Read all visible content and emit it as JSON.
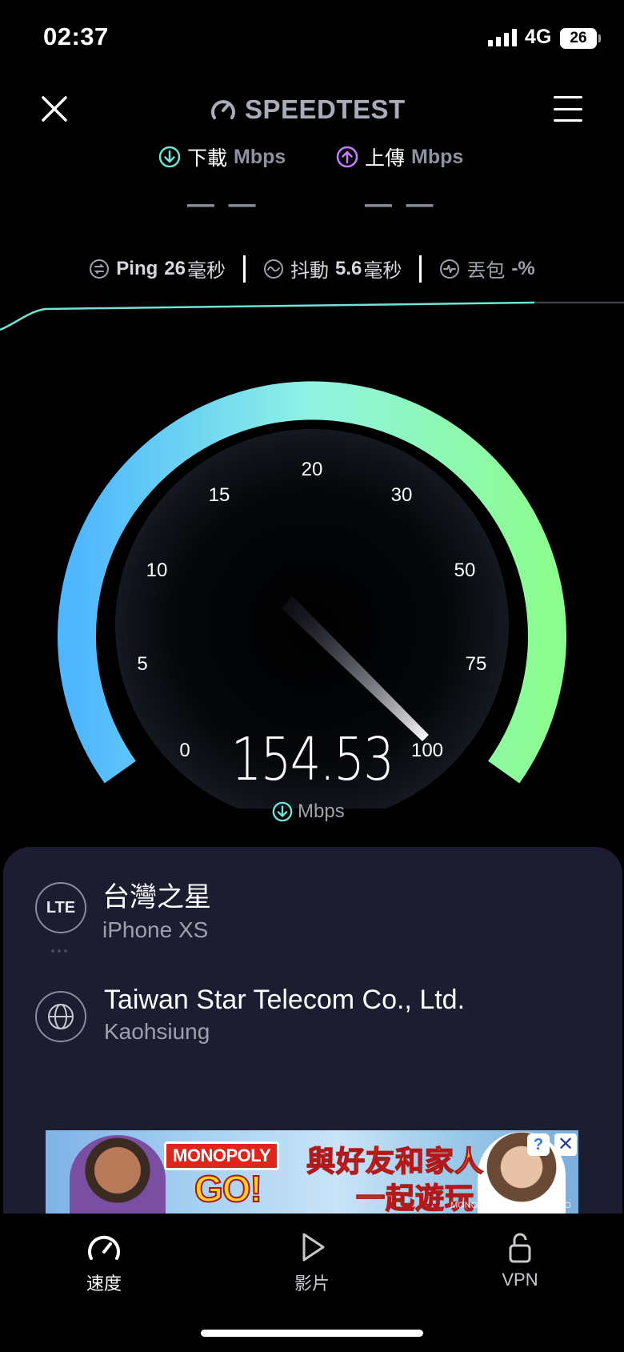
{
  "status": {
    "time": "02:37",
    "network": "4G",
    "battery": "26"
  },
  "header": {
    "logo_text": "SPEEDTEST",
    "close_icon": "close-icon",
    "menu_icon": "hamburger-menu-icon"
  },
  "download": {
    "label": "下載",
    "unit": "Mbps",
    "value": "— —",
    "color": "#6fe3d6"
  },
  "upload": {
    "label": "上傳",
    "unit": "Mbps",
    "value": "— —",
    "color": "#c77dff"
  },
  "ping": {
    "label": "Ping",
    "value": "26",
    "unit": "毫秒"
  },
  "jitter": {
    "label": "抖動",
    "value": "5.6",
    "unit": "毫秒"
  },
  "loss": {
    "label": "丟包",
    "value": "-%"
  },
  "gauge": {
    "ticks": [
      "0",
      "5",
      "10",
      "15",
      "20",
      "30",
      "50",
      "75",
      "100"
    ],
    "speed": "154.53",
    "unit": "Mbps",
    "gradient_start": "#4fb6ff",
    "gradient_end": "#8dfc8f"
  },
  "provider": {
    "name": "台灣之星",
    "device": "iPhone XS",
    "badge": "LTE"
  },
  "server": {
    "name": "Taiwan Star Telecom Co., Ltd.",
    "location": "Kaohsiung"
  },
  "ad": {
    "brand": "MONOPOLY",
    "brand2": "GO!",
    "line1": "與好友和家人",
    "line2": "一起遊玩",
    "copyright": "MONOPOLY © 2023 HASBRO"
  },
  "tabs": [
    {
      "label": "速度",
      "icon": "speedometer-icon"
    },
    {
      "label": "影片",
      "icon": "play-icon"
    },
    {
      "label": "VPN",
      "icon": "lock-icon"
    }
  ]
}
